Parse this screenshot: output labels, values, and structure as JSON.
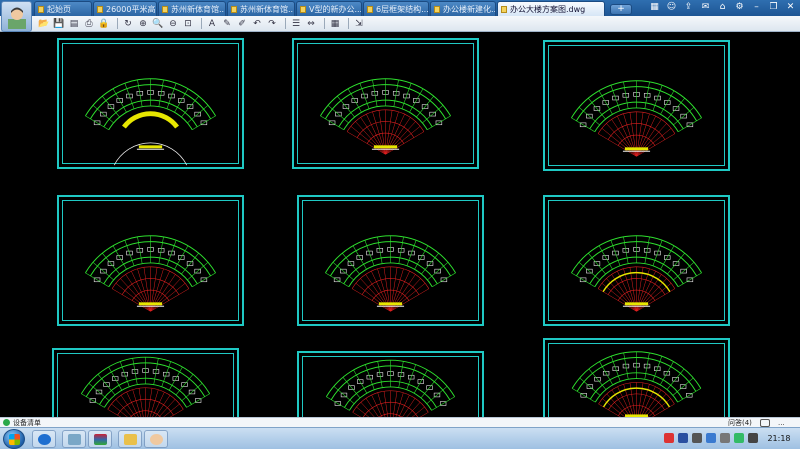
{
  "window": {
    "tabs": [
      {
        "label": "起始页",
        "active": false
      },
      {
        "label": "26000平米高...",
        "active": false
      },
      {
        "label": "苏州新体育馆...",
        "active": false
      },
      {
        "label": "苏州新体育馆...",
        "active": false
      },
      {
        "label": "V型的新办公...",
        "active": false
      },
      {
        "label": "6层框架结构...",
        "active": false
      },
      {
        "label": "办公楼新建化...",
        "active": false
      },
      {
        "label": "办公大楼方案图.dwg",
        "active": true
      }
    ],
    "new_tab_label": "+",
    "title_icons": [
      "grid-icon",
      "user-icon",
      "share-icon",
      "chat-icon",
      "mail-icon",
      "settings-icon",
      "minimize-icon",
      "restore-icon",
      "close-icon"
    ]
  },
  "toolbar": {
    "icons": [
      "open-icon",
      "save-icon",
      "saveas-icon",
      "print-icon",
      "lock-icon",
      "rotate-icon",
      "zoom-window-icon",
      "zoom-in-icon",
      "zoom-out-icon",
      "pan-icon",
      "text-icon",
      "pencil-icon",
      "marker-icon",
      "undo-icon",
      "redo-icon",
      "layer-icon",
      "dimension-icon",
      "stack-icon",
      "export-icon"
    ]
  },
  "canvas": {
    "background": "#000000",
    "frame_color": "#1fc9c4",
    "sheet_count": 9
  },
  "statusbar": {
    "left_text": "设备清单",
    "right_text": "问答(4)",
    "more": "..."
  },
  "taskbar": {
    "clock": "21:18",
    "apps": [
      "explorer",
      "cad",
      "winrar",
      "folder",
      "avatar"
    ]
  },
  "colors": {
    "plan_green": "#2ee02e",
    "plan_white": "#f0f0f0",
    "plan_red": "#e02020",
    "plan_yellow": "#e6e600",
    "frame_cyan": "#1fc9c4"
  }
}
